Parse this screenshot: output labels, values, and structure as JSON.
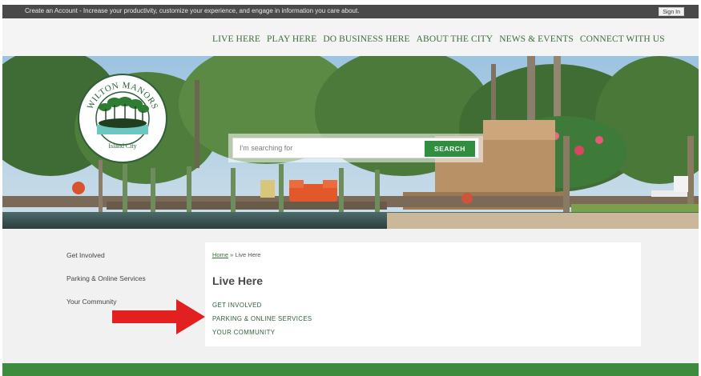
{
  "topbar": {
    "message": "Create an Account - Increase your productivity, customize your experience, and engage in information you care about.",
    "signin_label": "Sign In"
  },
  "logo": {
    "city_name": "WILTON MANORS",
    "tagline": "Island City"
  },
  "nav": {
    "items": [
      {
        "label": "LIVE HERE"
      },
      {
        "label": "PLAY HERE"
      },
      {
        "label": "DO BUSINESS HERE"
      },
      {
        "label": "ABOUT THE CITY"
      },
      {
        "label": "NEWS & EVENTS"
      },
      {
        "label": "CONNECT WITH US"
      }
    ]
  },
  "search": {
    "placeholder": "I'm searching for",
    "button_label": "SEARCH"
  },
  "sidebar": {
    "items": [
      {
        "label": "Get Involved"
      },
      {
        "label": "Parking & Online Services"
      },
      {
        "label": "Your Community"
      }
    ]
  },
  "breadcrumb": {
    "home": "Home",
    "separator": "»",
    "current": "Live Here"
  },
  "main": {
    "title": "Live Here",
    "links": [
      {
        "label": "GET INVOLVED"
      },
      {
        "label": "PARKING & ONLINE SERVICES"
      },
      {
        "label": "YOUR COMMUNITY"
      }
    ]
  },
  "colors": {
    "brand_green": "#3a6e3a",
    "button_green": "#2f8f3f",
    "footer_green": "#3d8b3d",
    "arrow_red": "#e32020",
    "topbar_gray": "#4a4a4a"
  }
}
